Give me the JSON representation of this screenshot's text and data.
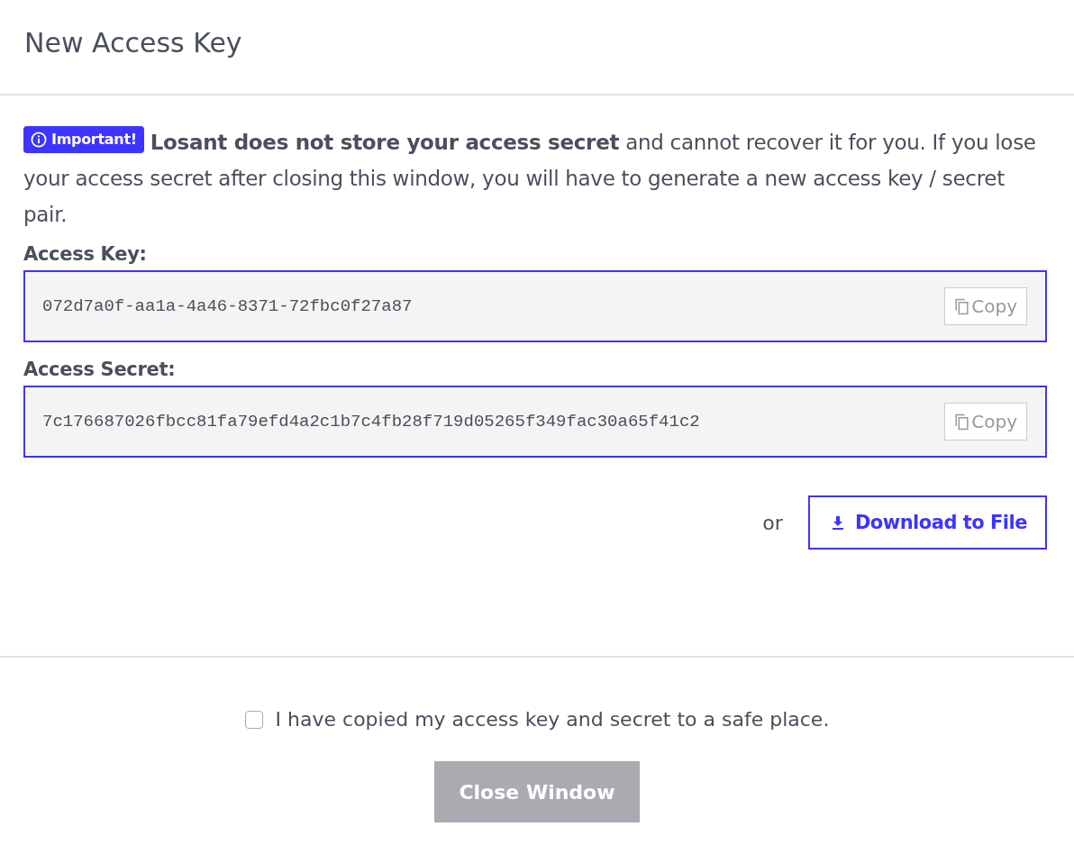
{
  "dialog": {
    "title": "New Access Key"
  },
  "notice": {
    "badge": "Important!",
    "text": "**Losant does not store your access secret** and cannot recover it for you. If you lose your access secret after closing this window, you will have to generate a new access key / secret pair."
  },
  "fields": [
    {
      "label": "Access Key:",
      "value": "072d7a0f-aa1a-4a46-8371-72fbc0f27a87",
      "copy_button": "Copy"
    },
    {
      "label": "Access Secret:",
      "value": "7c176687026fbcc81fa79efd4a2c1b7c4fb28f719d05265f349fac30a65f41c2",
      "copy_button": "Copy"
    }
  ],
  "download": {
    "separator": "or",
    "button": "Download to File"
  },
  "confirm": {
    "label": "I have copied my access key and secret to a safe place.",
    "checked": false
  },
  "close_button": {
    "label": "Close Window",
    "disabled": true
  }
}
